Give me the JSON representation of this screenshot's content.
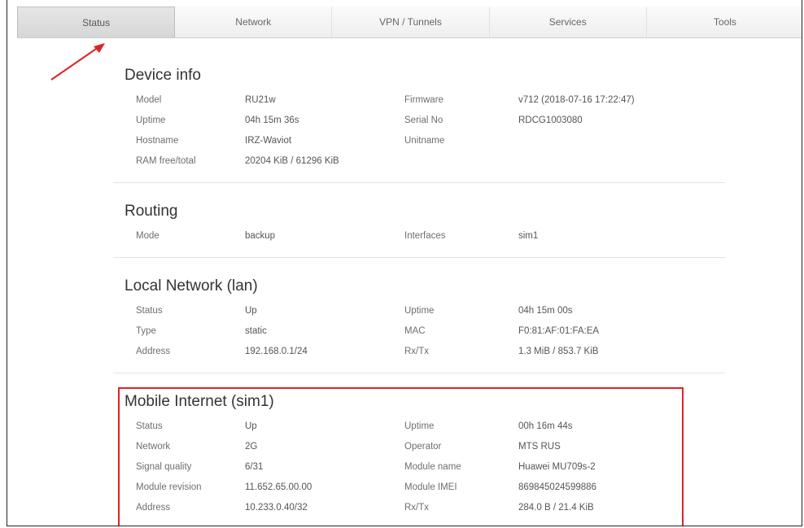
{
  "nav": {
    "tabs": [
      {
        "label": "Status"
      },
      {
        "label": "Network"
      },
      {
        "label": "VPN / Tunnels"
      },
      {
        "label": "Services"
      },
      {
        "label": "Tools"
      }
    ],
    "active": "Status"
  },
  "annotation": {
    "arrow_color": "#e02424",
    "box_color": "#e02424"
  },
  "sections": {
    "device": {
      "title": "Device info",
      "rows": [
        {
          "l1": "Model",
          "v1": "RU21w",
          "l2": "Firmware",
          "v2": "v712 (2018-07-16 17:22:47)"
        },
        {
          "l1": "Uptime",
          "v1": "04h 15m 36s",
          "l2": "Serial No",
          "v2": "RDCG1003080"
        },
        {
          "l1": "Hostname",
          "v1": "IRZ-Waviot",
          "l2": "Unitname",
          "v2": ""
        },
        {
          "l1": "RAM free/total",
          "v1": "20204 KiB / 61296 KiB",
          "l2": "",
          "v2": ""
        }
      ]
    },
    "routing": {
      "title": "Routing",
      "rows": [
        {
          "l1": "Mode",
          "v1": "backup",
          "l2": "Interfaces",
          "v2": "sim1"
        }
      ]
    },
    "lan": {
      "title": "Local Network (lan)",
      "rows": [
        {
          "l1": "Status",
          "v1": "Up",
          "l2": "Uptime",
          "v2": "04h 15m 00s"
        },
        {
          "l1": "Type",
          "v1": "static",
          "l2": "MAC",
          "v2": "F0:81:AF:01:FA:EA"
        },
        {
          "l1": "Address",
          "v1": "192.168.0.1/24",
          "l2": "Rx/Tx",
          "v2": "1.3 MiB / 853.7 KiB"
        }
      ]
    },
    "mobile": {
      "title": "Mobile Internet (sim1)",
      "rows": [
        {
          "l1": "Status",
          "v1": "Up",
          "l2": "Uptime",
          "v2": "00h 16m 44s"
        },
        {
          "l1": "Network",
          "v1": "2G",
          "l2": "Operator",
          "v2": "MTS RUS"
        },
        {
          "l1": "Signal quality",
          "v1": "6/31",
          "l2": "Module name",
          "v2": "Huawei MU709s-2"
        },
        {
          "l1": "Module revision",
          "v1": "11.652.65.00.00",
          "l2": "Module IMEI",
          "v2": "869845024599886"
        },
        {
          "l1": "Address",
          "v1": "10.233.0.40/32",
          "l2": "Rx/Tx",
          "v2": "284.0 B / 21.4 KiB"
        }
      ]
    }
  }
}
